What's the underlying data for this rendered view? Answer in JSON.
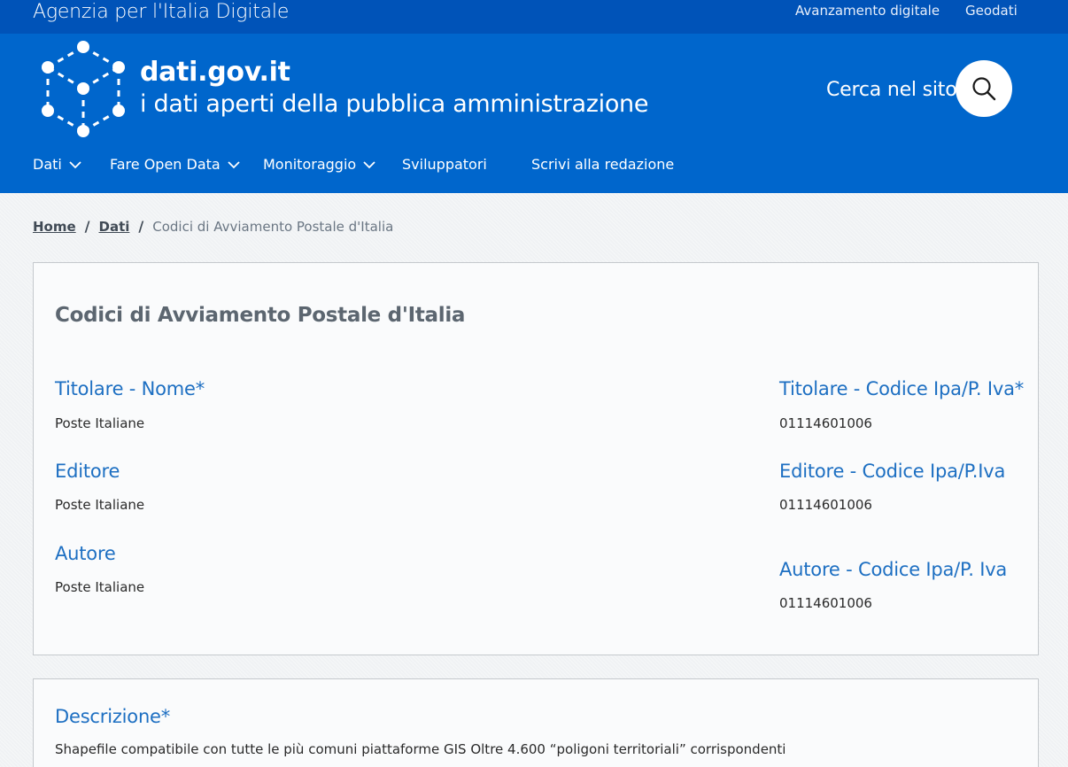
{
  "topbar": {
    "agency": "Agenzia per l'Italia Digitale",
    "links": [
      "Avanzamento digitale",
      "Geodati"
    ]
  },
  "header": {
    "site_name": "dati.gov.it",
    "tagline": "i dati aperti della pubblica amministrazione",
    "search_label": "Cerca nel sito",
    "brand_color": "#0066cc",
    "topbar_color": "#0053b8"
  },
  "nav": [
    {
      "label": "Dati",
      "has_dropdown": true
    },
    {
      "label": "Fare Open Data",
      "has_dropdown": true
    },
    {
      "label": "Monitoraggio",
      "has_dropdown": true
    },
    {
      "label": "Sviluppatori",
      "has_dropdown": false
    },
    {
      "label": "Scrivi alla redazione",
      "has_dropdown": false
    }
  ],
  "breadcrumb": {
    "home": "Home",
    "section": "Dati",
    "current": "Codici di Avviamento Postale d'Italia"
  },
  "dataset": {
    "title": "Codici di Avviamento Postale d'Italia",
    "fields": {
      "titolare_nome": {
        "label": "Titolare - Nome*",
        "value": "Poste Italiane"
      },
      "titolare_codice": {
        "label": "Titolare - Codice Ipa/P. Iva*",
        "value": "01114601006"
      },
      "editore": {
        "label": "Editore",
        "value": "Poste Italiane"
      },
      "editore_codice": {
        "label": "Editore - Codice Ipa/P.Iva",
        "value": "01114601006"
      },
      "autore": {
        "label": "Autore",
        "value": "Poste Italiane"
      },
      "autore_codice": {
        "label": "Autore - Codice Ipa/P. Iva",
        "value": "01114601006"
      }
    },
    "description": {
      "label": "Descrizione*",
      "text": "Shapefile compatibile con tutte le più comuni piattaforme GIS Oltre 4.600 “poligoni territoriali” corrispondenti"
    }
  },
  "icons": {
    "logo": "hexagon-network-icon",
    "search": "search-icon",
    "dropdown": "chevron-down-icon"
  }
}
